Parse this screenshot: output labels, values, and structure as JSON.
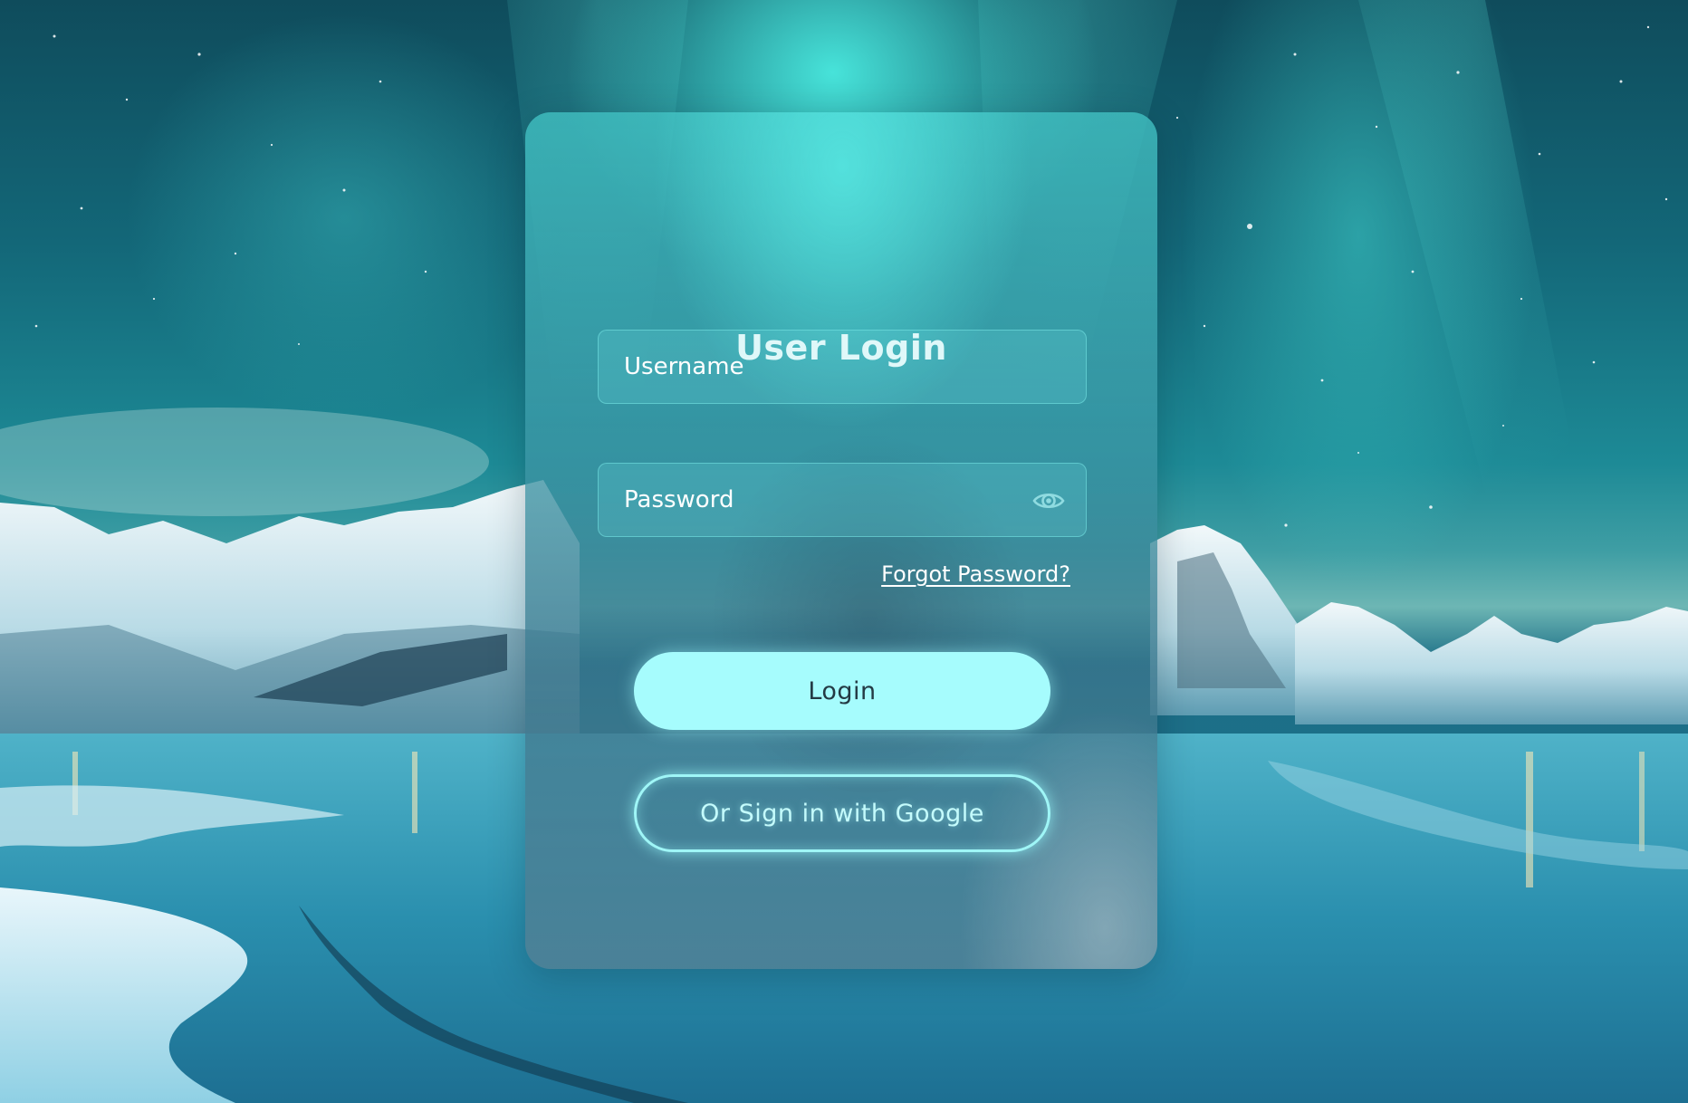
{
  "page": {
    "title": "User Login"
  },
  "form": {
    "username": {
      "placeholder": "Username",
      "value": ""
    },
    "password": {
      "placeholder": "Password",
      "value": "",
      "toggle_icon": "eye-icon"
    },
    "forgot_password_label": "Forgot Password?",
    "login_label": "Login",
    "google_label": "Or Sign in with Google"
  },
  "colors": {
    "accent": "#a6fcfd",
    "google_border": "#9ff6f7",
    "login_text": "#243a44"
  }
}
